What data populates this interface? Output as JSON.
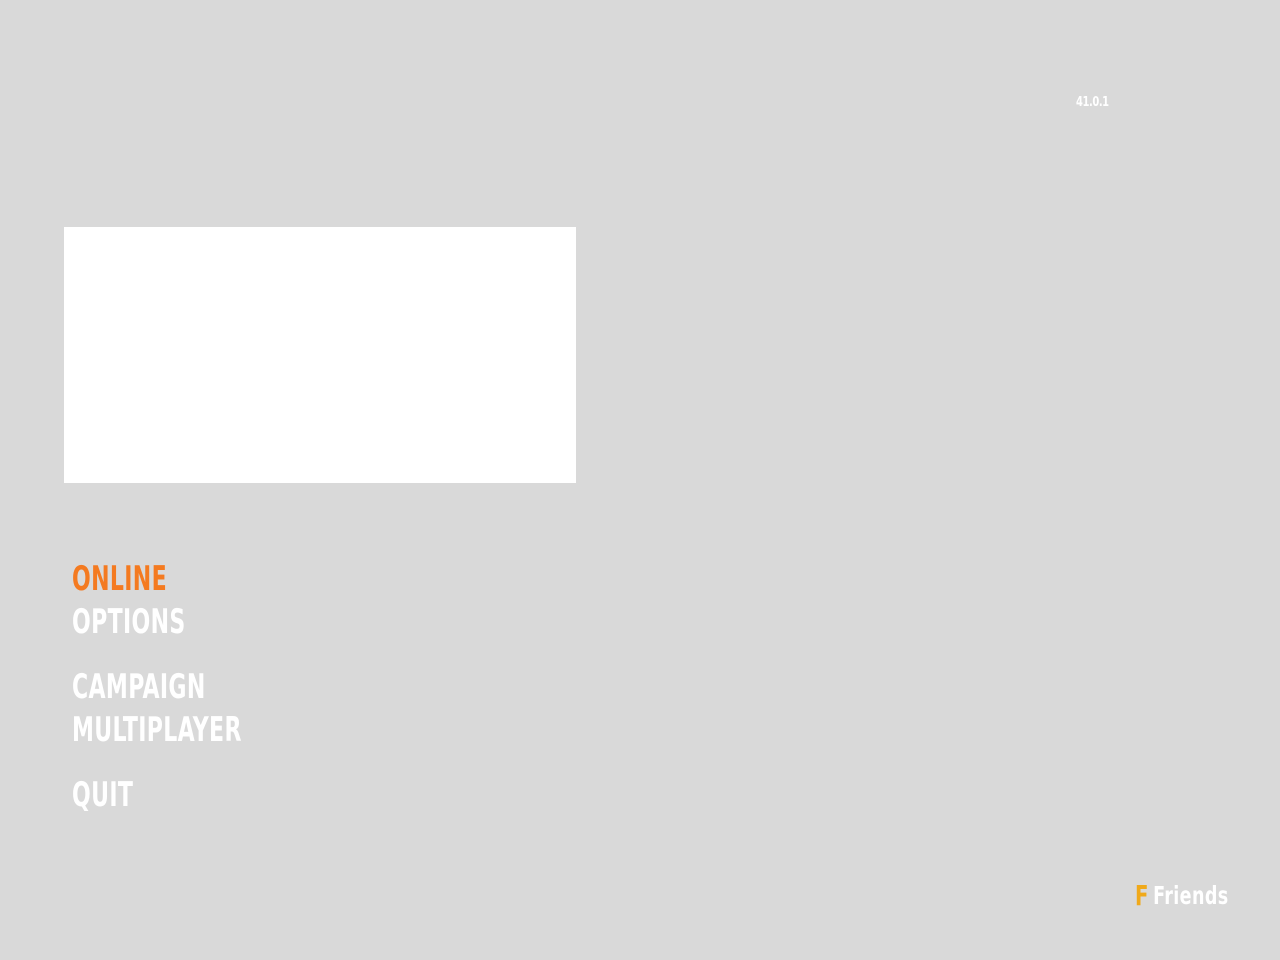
{
  "version": "41.0.1",
  "menu": {
    "items": [
      {
        "label": "ONLINE",
        "active": true
      },
      {
        "label": "OPTIONS",
        "active": false
      },
      {
        "label": "CAMPAIGN",
        "active": false
      },
      {
        "label": "MULTIPLAYER",
        "active": false
      },
      {
        "label": "QUIT",
        "active": false
      }
    ]
  },
  "friends": {
    "key": "F",
    "label": "Friends"
  },
  "colors": {
    "background": "#d9d9d9",
    "active": "#f47a20",
    "key_hint": "#f0a91a",
    "text": "#ffffff"
  }
}
